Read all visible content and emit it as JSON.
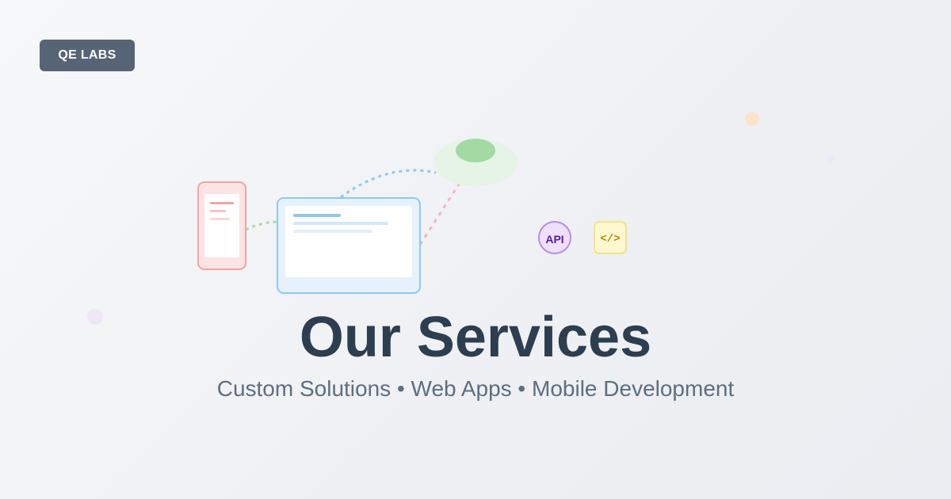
{
  "brand": {
    "label": "QE LABS"
  },
  "hero": {
    "title": "Our Services",
    "subtitle": "Custom Solutions • Web Apps • Mobile Development"
  },
  "badges": {
    "api": "API",
    "code": "</>"
  },
  "colors": {
    "brand_bg": "#566475",
    "title": "#2c3e50",
    "subtitle": "#5e6e80",
    "phone": "#f4a3a3",
    "browser": "#90c8f0",
    "cloud": "#a3d9a3",
    "api_badge": "#b98ce6",
    "code_badge": "#f6e08a"
  },
  "icons": [
    "phone-icon",
    "browser-window-icon",
    "cloud-icon",
    "api-badge-icon",
    "code-badge-icon"
  ]
}
